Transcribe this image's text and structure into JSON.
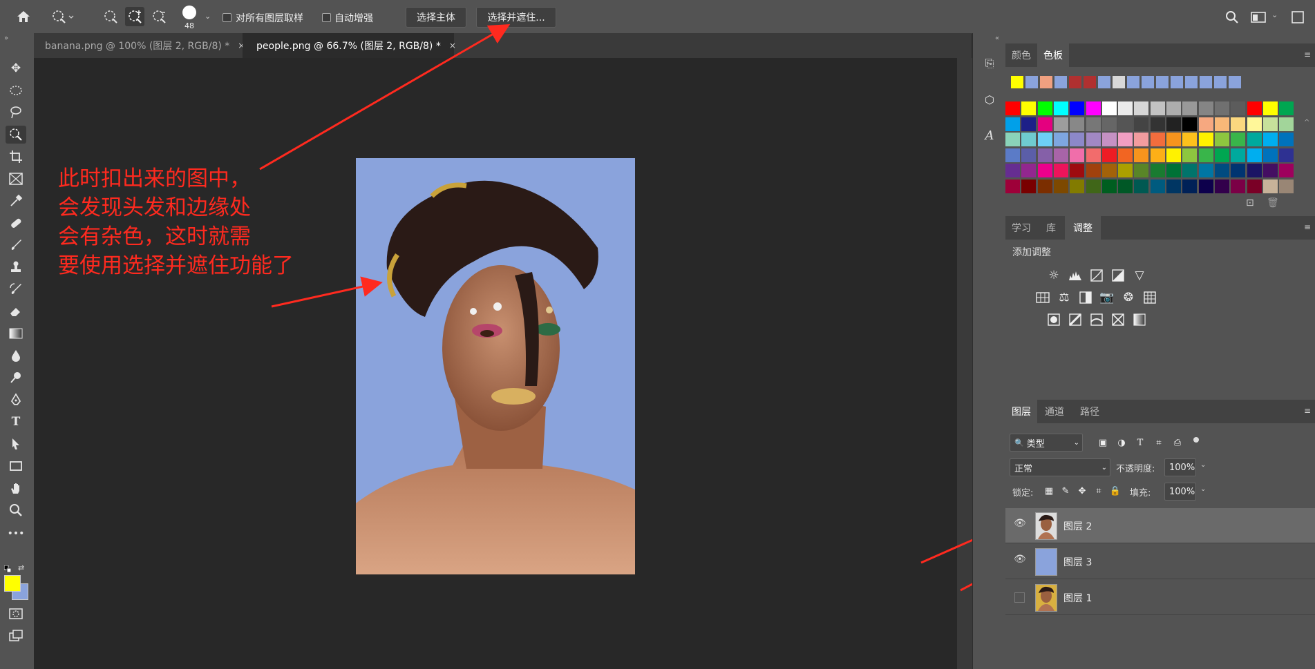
{
  "options_bar": {
    "brush_size": "48",
    "sample_all_layers_label": "对所有图层取样",
    "auto_enhance_label": "自动增强",
    "select_subject_label": "选择主体",
    "select_and_mask_label": "选择并遮住..."
  },
  "tabs": [
    {
      "label": "banana.png @ 100% (图层 2, RGB/8) *",
      "close": "×"
    },
    {
      "label": "people.png @ 66.7% (图层 2, RGB/8) *",
      "close": "×"
    }
  ],
  "annotation": {
    "lines": [
      "此时扣出来的图中，",
      "会发现头发和边缘处",
      "会有杂色，这时就需",
      "要使用选择并遮住功能了"
    ],
    "color": "#ff2a1f"
  },
  "colors": {
    "foreground": "#ffff00",
    "background": "#8aa3dc",
    "photo_bg": "#8aa3dc"
  },
  "swatches_panel": {
    "tabs": [
      "颜色",
      "色板"
    ],
    "recent": [
      "#ffff00",
      "#8aa3dc",
      "#f0a080",
      "#8aa3dc",
      "#b03030",
      "#b03030",
      "#8aa3dc",
      "#d8d8d8",
      "#8aa3dc",
      "#8aa3dc",
      "#8aa3dc",
      "#8aa3dc",
      "#8aa3dc",
      "#8aa3dc",
      "#8aa3dc",
      "#8aa3dc"
    ],
    "grid": [
      [
        "#ff0000",
        "#ffff00",
        "#00ff00",
        "#00ffff",
        "#0000ff",
        "#ff00ff",
        "#ffffff",
        "#ebebeb",
        "#d6d6d6",
        "#c2c2c2",
        "#adadad",
        "#999999",
        "#858585",
        "#707070",
        "#5c5c5c",
        "#ff0000",
        "#ffff00",
        "#00a651"
      ],
      [
        "#00a0e9",
        "#1d2088",
        "#e4007f",
        "#9d9d9d",
        "#888888",
        "#777777",
        "#666666",
        "#555555",
        "#444444",
        "#333333",
        "#222222",
        "#000000",
        "#f6a880",
        "#f8b878",
        "#fbd87f",
        "#fff799",
        "#c7e19b",
        "#a2d59a"
      ],
      [
        "#8ad3b9",
        "#6fcbd0",
        "#6dcff6",
        "#7ea6e0",
        "#8c88c9",
        "#a188c4",
        "#c591c3",
        "#f19ec2",
        "#f29c9f",
        "#f26d3d",
        "#f7941d",
        "#fdc01c",
        "#fff200",
        "#8dc63f",
        "#39b54a",
        "#00a99d",
        "#00aeef",
        "#0072bc"
      ],
      [
        "#5b7bc7",
        "#5b5ea8",
        "#8560a8",
        "#a864a8",
        "#f06eaa",
        "#f26c6c",
        "#ed1c24",
        "#f26522",
        "#f7941d",
        "#fcaf17",
        "#fff200",
        "#8dc63f",
        "#39b54a",
        "#00a651",
        "#00a99d",
        "#00aeef",
        "#0072bc",
        "#2e3192"
      ],
      [
        "#662d91",
        "#92278f",
        "#ec008c",
        "#ed145b",
        "#9e0b0f",
        "#a0410d",
        "#a36209",
        "#aba000",
        "#598527",
        "#197b30",
        "#007236",
        "#00746b",
        "#0076a3",
        "#004b80",
        "#003471",
        "#1b1464",
        "#440e62",
        "#9e005d"
      ],
      [
        "#9e0039",
        "#790000",
        "#7b2e00",
        "#7d4900",
        "#827b00",
        "#406618",
        "#005e20",
        "#005826",
        "#005952",
        "#005b7f",
        "#003663",
        "#002157",
        "#0d004c",
        "#32004b",
        "#7b0046",
        "#7a0026",
        "#c7b299",
        "#998675"
      ]
    ]
  },
  "adjust_panel": {
    "tabs": [
      "学习",
      "库",
      "调整"
    ],
    "title": "添加调整"
  },
  "layers_panel": {
    "tabs": [
      "图层",
      "通道",
      "路径"
    ],
    "filter_label": "类型",
    "blend_mode": "正常",
    "opacity_label": "不透明度:",
    "opacity_value": "100%",
    "lock_label": "锁定:",
    "fill_label": "填充:",
    "fill_value": "100%",
    "layers": [
      {
        "name": "图层 2",
        "visible": true,
        "selected": true
      },
      {
        "name": "图层 3",
        "visible": true,
        "selected": false
      },
      {
        "name": "图层 1",
        "visible": false,
        "selected": false
      }
    ]
  }
}
